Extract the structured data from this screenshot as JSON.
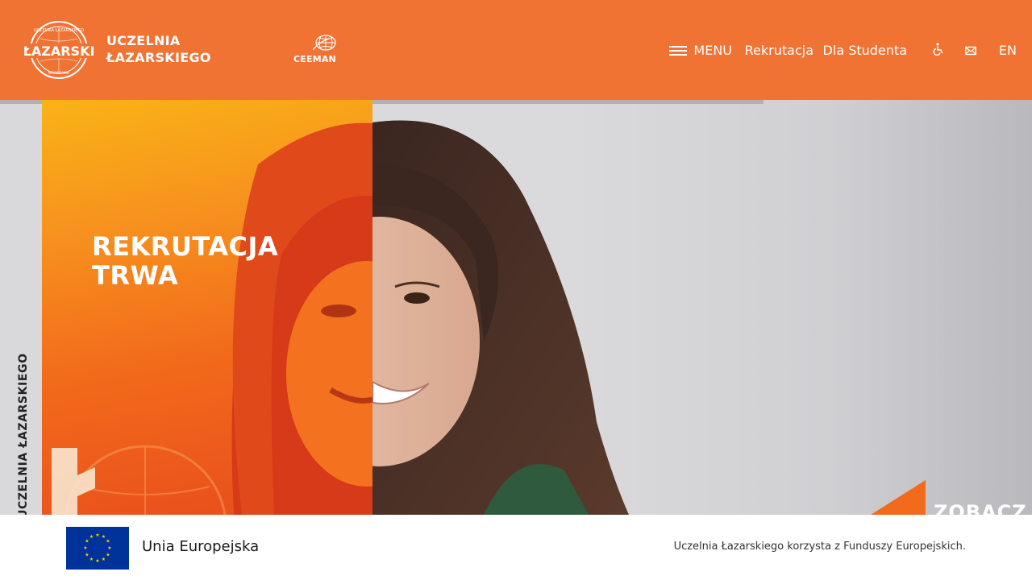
{
  "header": {
    "logo_seal_text": "UCZELNIA ŁAZARSKIEGO ŁAZARSKI WARSZAWA",
    "logo_line1": "UCZELNIA",
    "logo_line2": "ŁAZARSKIEGO",
    "partner_logo": "CEEMAN",
    "nav": {
      "menu_label": "MENU",
      "recruitment_label": "Rekrutacja",
      "student_label": "Dla Studenta",
      "accessibility_icon": "wheelchair-icon",
      "mail_icon": "envelope-icon",
      "language_label": "EN"
    },
    "colors": {
      "brand_orange": "#f07333"
    }
  },
  "hero": {
    "title_line1": "REKRUTACJA",
    "title_line2": "TRWA",
    "vertical_brand": "UCZELNIA ŁAZARSKIEGO",
    "cta_label": "ZOBACZ",
    "colors": {
      "panel_top": "#f9b316",
      "panel_bottom": "#e84d1c"
    }
  },
  "eu_bar": {
    "label": "Unia Europejska",
    "note": "Uczelnia Łazarskiego korzysta z Funduszy Europejskich.",
    "flag_icon": "eu-flag-icon",
    "colors": {
      "flag_blue": "#003399",
      "flag_star": "#ffcc00"
    }
  }
}
